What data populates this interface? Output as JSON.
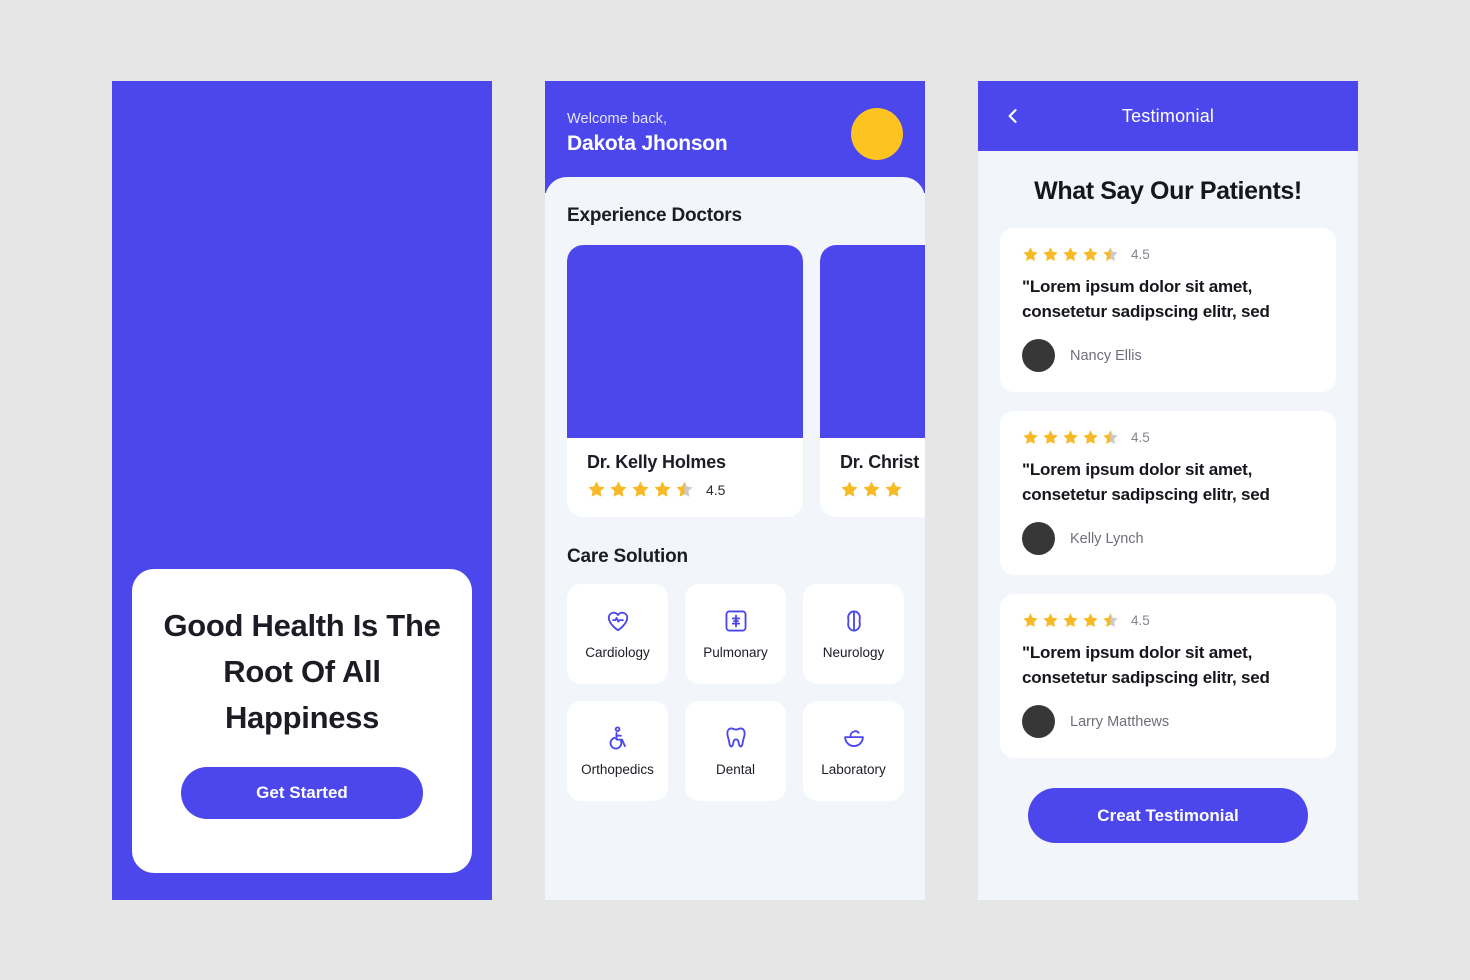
{
  "theme": {
    "primary": "#4b47ec",
    "screen_bg": "#f2f5f9",
    "page_bg": "#e6e6e6",
    "star_gold": "#f7b924",
    "star_gray": "#c9c9ce",
    "avatar_gold": "#fcc321",
    "avatar_dark": "#373737"
  },
  "screen_onboarding": {
    "headline": "Good Health Is The Root Of All Happiness",
    "cta_label": "Get Started"
  },
  "screen_home": {
    "welcome_label": "Welcome back,",
    "user_name": "Dakota Jhonson",
    "avatar_icon": "user-avatar-circle",
    "doctors_section_title": "Experience Doctors",
    "doctors": [
      {
        "name": "Dr. Kelly Holmes",
        "rating": "4.5",
        "stars": 4.5
      },
      {
        "name": "Dr. Christ",
        "rating": "",
        "stars": 3
      }
    ],
    "care_section_title": "Care Solution",
    "care_items": [
      {
        "label": "Cardiology",
        "icon": "heart-pulse-icon"
      },
      {
        "label": "Pulmonary",
        "icon": "lungs-frame-icon"
      },
      {
        "label": "Neurology",
        "icon": "brain-icon"
      },
      {
        "label": "Orthopedics",
        "icon": "wheelchair-icon"
      },
      {
        "label": "Dental",
        "icon": "tooth-icon"
      },
      {
        "label": "Laboratory",
        "icon": "mortar-pestle-icon"
      }
    ]
  },
  "screen_testimonial": {
    "back_icon": "chevron-left-icon",
    "nav_title": "Testimonial",
    "page_heading": "What Say Our Patients!",
    "testimonials": [
      {
        "rating": "4.5",
        "stars": 4.5,
        "quote": "\"Lorem ipsum dolor sit amet, consetetur sadipscing elitr, sed",
        "author": "Nancy Ellis"
      },
      {
        "rating": "4.5",
        "stars": 4.5,
        "quote": "\"Lorem ipsum dolor sit amet, consetetur sadipscing elitr, sed",
        "author": "Kelly Lynch"
      },
      {
        "rating": "4.5",
        "stars": 4.5,
        "quote": "\"Lorem ipsum dolor sit amet, consetetur sadipscing elitr, sed",
        "author": "Larry Matthews"
      }
    ],
    "cta_label": "Creat Testimonial"
  }
}
